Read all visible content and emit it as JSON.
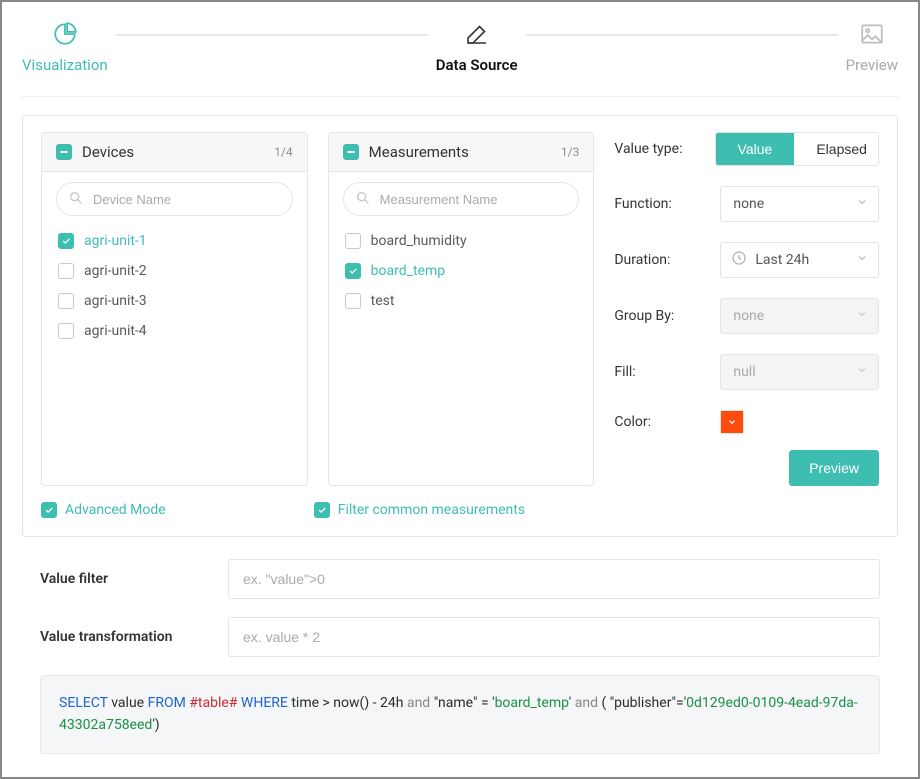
{
  "stepper": {
    "visualization": "Visualization",
    "datasource": "Data Source",
    "preview": "Preview"
  },
  "panels": {
    "devices": {
      "title": "Devices",
      "count": "1/4",
      "search_placeholder": "Device Name",
      "items": [
        {
          "label": "agri-unit-1",
          "checked": true
        },
        {
          "label": "agri-unit-2",
          "checked": false
        },
        {
          "label": "agri-unit-3",
          "checked": false
        },
        {
          "label": "agri-unit-4",
          "checked": false
        }
      ]
    },
    "measurements": {
      "title": "Measurements",
      "count": "1/3",
      "search_placeholder": "Measurement Name",
      "items": [
        {
          "label": "board_humidity",
          "checked": false
        },
        {
          "label": "board_temp",
          "checked": true
        },
        {
          "label": "test",
          "checked": false
        }
      ]
    }
  },
  "settings": {
    "value_type": {
      "label": "Value type:",
      "options": [
        "Value",
        "Elapsed"
      ],
      "active": "Value"
    },
    "function": {
      "label": "Function:",
      "value": "none"
    },
    "duration": {
      "label": "Duration:",
      "value": "Last 24h"
    },
    "group_by": {
      "label": "Group By:",
      "value": "none",
      "disabled": true
    },
    "fill": {
      "label": "Fill:",
      "value": "null",
      "disabled": true
    },
    "color": {
      "label": "Color:",
      "value": "#ff4c0c"
    },
    "preview_button": "Preview"
  },
  "toggles": {
    "advanced": "Advanced Mode",
    "filter_common": "Filter common measurements"
  },
  "filters": {
    "value_filter": {
      "label": "Value filter",
      "placeholder": "ex. \"value\">0"
    },
    "value_transformation": {
      "label": "Value transformation",
      "placeholder": "ex. value * 2"
    }
  },
  "query": {
    "select": "SELECT",
    "value_token": "value",
    "from": "FROM",
    "table": "#table#",
    "where": "WHERE",
    "time_expr": "time > now() - 24h",
    "and": "and",
    "name_clause_l": "\"name\" = '",
    "name_val": "board_temp",
    "name_clause_r": "'",
    "pub_clause": "( \"publisher\"='",
    "pub_val": "0d129ed0-0109-4ead-97da-43302a758eed",
    "pub_clause_r": "')"
  }
}
